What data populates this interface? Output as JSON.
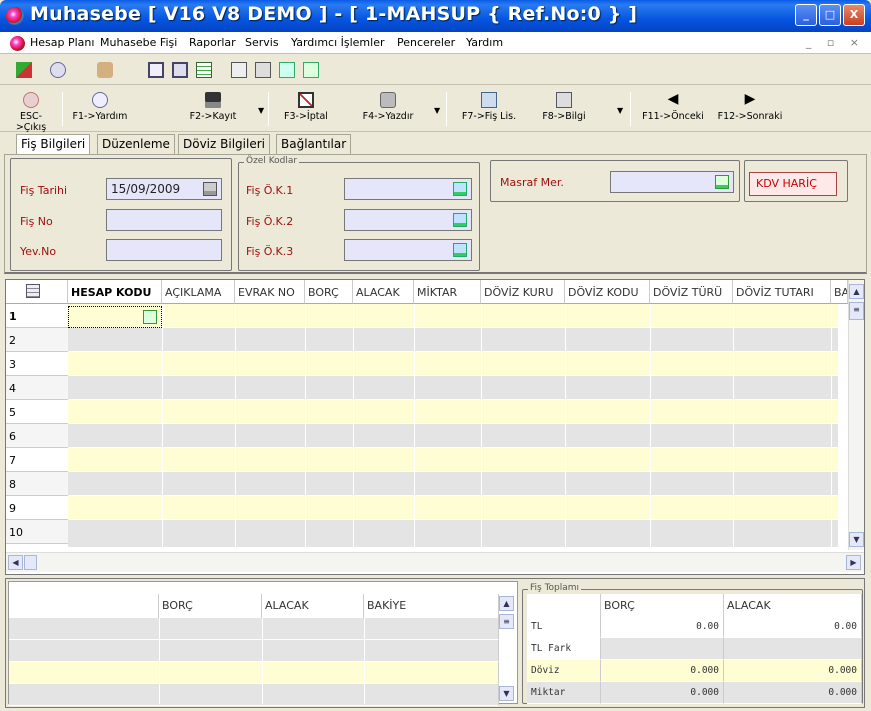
{
  "window": {
    "title": "Muhasebe [ V16 V8 DEMO ]  - [ 1-MAHSUP { Ref.No:0 } ]",
    "min": "_",
    "max": "□",
    "close": "X"
  },
  "menu": {
    "items": [
      "Hesap Planı",
      "Muhasebe Fişi",
      "Raporlar",
      "Servis",
      "Yardımcı İşlemler",
      "Pencereler",
      "Yardım"
    ],
    "mdi": "_ ▫ ×"
  },
  "toolbar": {
    "buttons": [
      {
        "label": "ESC->Çıkış",
        "icon": "close-icon"
      },
      {
        "label": "F1->Yardım",
        "icon": "help-icon"
      },
      {
        "label": "F2->Kayıt",
        "icon": "save-icon"
      },
      {
        "label": "F3->İptal",
        "icon": "cancel-icon"
      },
      {
        "label": "F4->Yazdır",
        "icon": "print-icon"
      },
      {
        "label": "F7->Fiş Lis.",
        "icon": "list-icon"
      },
      {
        "label": "F8->Bilgi",
        "icon": "info-icon"
      },
      {
        "label": "F11->Önceki",
        "icon": "arrow-left-icon"
      },
      {
        "label": "F12->Sonraki",
        "icon": "arrow-right-icon"
      }
    ]
  },
  "tabs": [
    "Fiş Bilgileri",
    "Düzenleme",
    "Döviz Bilgileri",
    "Bağlantılar"
  ],
  "form": {
    "fis_tarihi_label": "Fiş Tarihi",
    "fis_tarihi_value": "15/09/2009",
    "fis_no_label": "Fiş No",
    "yev_no_label": "Yev.No",
    "ozel_kodlar_title": "Özel Kodlar",
    "ok1_label": "Fiş Ö.K.1",
    "ok2_label": "Fiş Ö.K.2",
    "ok3_label": "Fiş Ö.K.3",
    "masraf_label": "Masraf Mer.",
    "kdv_label": "KDV HARİÇ"
  },
  "grid": {
    "columns": [
      "HESAP KODU",
      "AÇIKLAMA",
      "EVRAK NO",
      "BORÇ",
      "ALACAK",
      "MİKTAR",
      "DÖVİZ KURU",
      "DÖVİZ KODU",
      "DÖVİZ TÜRÜ",
      "DÖVİZ TUTARI",
      "BA"
    ],
    "rows": [
      "1",
      "2",
      "3",
      "4",
      "5",
      "6",
      "7",
      "8",
      "9",
      "10"
    ]
  },
  "summary": {
    "columns": [
      "BORÇ",
      "ALACAK",
      "BAKİYE"
    ]
  },
  "fis_toplami": {
    "title": "Fiş Toplamı",
    "columns": [
      "BORÇ",
      "ALACAK"
    ],
    "rows": [
      {
        "label": "TL",
        "borc": "0.00",
        "alacak": "0.00"
      },
      {
        "label": "TL Fark",
        "borc": "",
        "alacak": ""
      },
      {
        "label": "Döviz",
        "borc": "0.000",
        "alacak": "0.000"
      },
      {
        "label": "Miktar",
        "borc": "0.000",
        "alacak": "0.000"
      }
    ]
  }
}
